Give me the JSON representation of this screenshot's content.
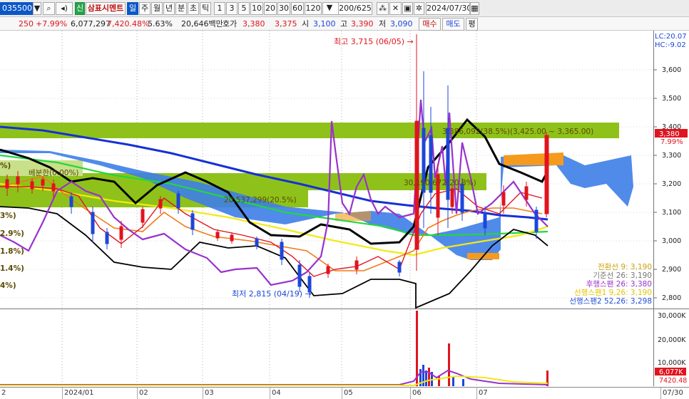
{
  "toolbar": {
    "code": "035500",
    "stock_name": "삼표시멘트",
    "period_buttons": [
      "일",
      "주",
      "월",
      "년",
      "분",
      "초",
      "틱"
    ],
    "interval_buttons": [
      "1",
      "3",
      "5",
      "10",
      "20",
      "30",
      "60",
      "120"
    ],
    "count_display": "200/625",
    "date": "2024/07/30",
    "new_badge": "신"
  },
  "infobar": {
    "change": "250",
    "change_pct": "+7.99%",
    "volume": "6,077,297",
    "volume_pct": "7,420.48%",
    "turnover_pct": "5.63%",
    "amount": "20,646백만",
    "quote_label": "호가",
    "ask": "3,380",
    "bid": "3,375",
    "open_label": "시",
    "open": "3,100",
    "high_label": "고",
    "high": "3,390",
    "low_label": "저",
    "low": "3,090",
    "buy_button": "매수",
    "sell_button": "매도",
    "eval_button": "평"
  },
  "chart": {
    "lc_label": "LC:20.07",
    "hc_label": "HC:-9.02",
    "price_ticks": [
      "3,600",
      "3,500",
      "3,400",
      "3,300",
      "3,200",
      "3,100",
      "3,000",
      "2,900",
      "2,800"
    ],
    "volume_ticks": [
      "30,000K",
      "20,000K",
      "10,000K"
    ],
    "current_price": "3,380",
    "current_pct": "7.99%",
    "current_volume": "6,077K",
    "current_volume_pct": "7420.48",
    "high_annotation": "최고 3,715 (06/05) →",
    "low_annotation": "최저 2,815 (04/19) →",
    "zone_upper": "3,386,092(38.5%)(3,425.00 ~ 3,365.00)",
    "zone_middle": "30,190,672(20.8%)",
    "zone_lower": "20,537,299(20.5%)",
    "zone_left": "베분한(0.00%)",
    "left_pcts": [
      "%)",
      "3%)",
      "2.9%)",
      "1.8%)",
      "1.4%)",
      "4%)"
    ],
    "legend": [
      {
        "label": "전환선 9: 3,190",
        "color": "#c9a20a"
      },
      {
        "label": "기준선 26: 3,190",
        "color": "#777777"
      },
      {
        "label": "후행스팬 26: 3,380",
        "color": "#9932cc"
      },
      {
        "label": "선행스팬1 9,26: 3,190",
        "color": "#e5c400"
      },
      {
        "label": "선행스팬2 52,26: 3,298",
        "color": "#1f4fd6"
      }
    ]
  },
  "xaxis": {
    "labels": [
      "2",
      "2024/01",
      "02",
      "03",
      "04",
      "05",
      "06",
      "07",
      "07/30"
    ]
  }
}
